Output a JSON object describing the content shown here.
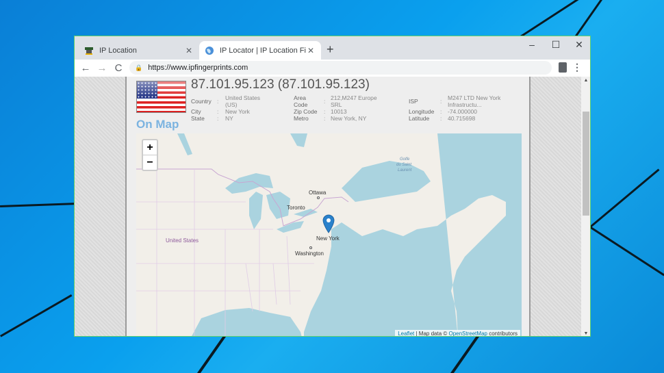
{
  "browser": {
    "tabs": [
      {
        "title": "IP Location",
        "icon": "site-logo-icon",
        "active": false
      },
      {
        "title": "IP Locator | IP Location Finder | L",
        "icon": "globe-icon",
        "active": true
      }
    ],
    "new_tab_label": "+",
    "window_controls": {
      "minimize": "–",
      "maximize": "☐",
      "close": "✕"
    },
    "nav": {
      "back": "←",
      "forward": "→",
      "reload": "C"
    },
    "url": "https://www.ipfingerprints.com",
    "menu_label": "⋮"
  },
  "ip_info": {
    "heading": "87.101.95.123 (87.101.95.123)",
    "fields": {
      "country": {
        "label": "Country",
        "value_line1": "United States",
        "value_line2": "(US)"
      },
      "city": {
        "label": "City",
        "value": "New York"
      },
      "state": {
        "label": "State",
        "value": "NY"
      },
      "area_code": {
        "label_line1": "Area",
        "label_line2": "Code",
        "value_line1": "212,M247 Europe",
        "value_line2": "SRL"
      },
      "zip_code": {
        "label": "Zip Code",
        "value": "10013"
      },
      "metro": {
        "label": "Metro",
        "value": "New York, NY"
      },
      "isp": {
        "label": "ISP",
        "value_line1": "M247 LTD New York",
        "value_line2": "Infrastructu..."
      },
      "longitude": {
        "label": "Longitude",
        "value": "-74.000000"
      },
      "latitude": {
        "label": "Latitude",
        "value": "40.715698"
      }
    },
    "separator": ":"
  },
  "map_section": {
    "heading": "On Map",
    "zoom_in": "+",
    "zoom_out": "−",
    "labels": {
      "ottawa": "Ottawa",
      "toronto": "Toronto",
      "new_york": "New York",
      "washington": "Washington",
      "united_states": "United States",
      "gulf_line1": "Golfe",
      "gulf_line2": "du Saint",
      "gulf_line3": "Laurent"
    },
    "attribution": {
      "leaflet": "Leaflet",
      "middle": " | Map data © ",
      "osm": "OpenStreetMap",
      "suffix": " contributors"
    },
    "colors": {
      "water": "#aad3df",
      "land": "#f2efe9",
      "border": "#c8a6d2",
      "marker": "#2a81cb"
    }
  }
}
